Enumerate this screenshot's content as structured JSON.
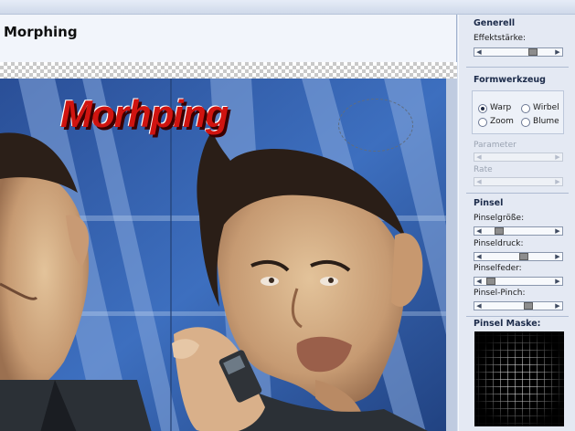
{
  "window": {
    "title": "Morphing"
  },
  "canvas": {
    "headline": "Morhping"
  },
  "panel": {
    "generell": {
      "title": "Generell",
      "effektstaerke": {
        "label": "Effektstärke:",
        "value": 0.62
      }
    },
    "formwerkzeug": {
      "title": "Formwerkzeug",
      "options": [
        {
          "label": "Warp",
          "checked": true
        },
        {
          "label": "Wirbel",
          "checked": false
        },
        {
          "label": "Zoom",
          "checked": false
        },
        {
          "label": "Blume",
          "checked": false
        }
      ],
      "parameter": {
        "label": "Parameter",
        "enabled": false
      },
      "rate": {
        "label": "Rate",
        "enabled": false
      }
    },
    "pinsel": {
      "title": "Pinsel",
      "pinselgroesse": {
        "label": "Pinselgröße:",
        "value": 0.25
      },
      "pinseldruck": {
        "label": "Pinseldruck:",
        "value": 0.55
      },
      "pinselfeder": {
        "label": "Pinselfeder:",
        "value": 0.15
      },
      "pinsel_pinch": {
        "label": "Pinsel-Pinch:",
        "value": 0.6
      }
    },
    "maske": {
      "title": "Pinsel Maske:"
    }
  },
  "icons": [
    "radio-button",
    "slider-arrow-left",
    "slider-arrow-right"
  ]
}
